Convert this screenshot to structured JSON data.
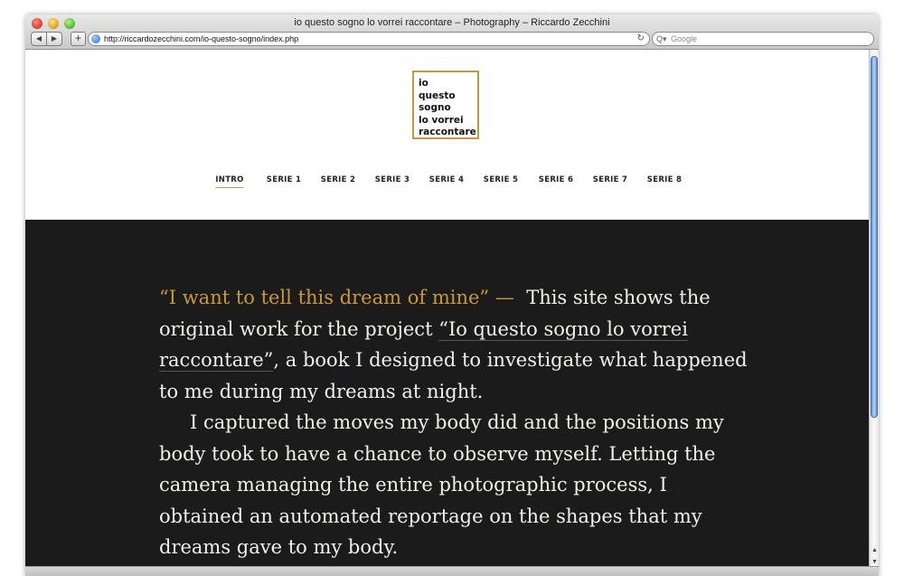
{
  "window": {
    "title": "io questo sogno lo vorrei raccontare – Photography – Riccardo Zecchini"
  },
  "toolbar": {
    "back_icon": "◀",
    "forward_icon": "▶",
    "add_icon": "+",
    "url": "http://riccardozecchini.com/io-questo-sogno/index.php",
    "reload_icon": "↻",
    "search_placeholder": "Google",
    "search_icon": "Q▾"
  },
  "logo": {
    "lines": [
      "io",
      "questo",
      "sogno",
      "lo vorrei",
      "raccontare"
    ],
    "border_color": "#c29a43"
  },
  "nav": {
    "items": [
      {
        "label": "INTRO",
        "active": true
      },
      {
        "label": "SERIE 1"
      },
      {
        "label": "SERIE 2"
      },
      {
        "label": "SERIE 3"
      },
      {
        "label": "SERIE 4"
      },
      {
        "label": "SERIE 5"
      },
      {
        "label": "SERIE 6"
      },
      {
        "label": "SERIE 7"
      },
      {
        "label": "SERIE 8"
      }
    ]
  },
  "content": {
    "quote": "“I want to tell this dream of mine”",
    "dash": "—",
    "p1_a": "This site shows the original work for the project",
    "p1_link": "“Io questo sogno lo vorrei raccontare”",
    "p1_b": ", a book I designed to investigate what happened to me during my dreams at night.",
    "p2": "I captured the moves my body did and the positions my body took to have a chance to observe myself. Letting the camera managing the entire photographic process, I obtained an automated reportage on the shapes that my dreams gave to my body."
  },
  "colors": {
    "accent": "#c99838",
    "dark_bg": "#1b1b1b",
    "text_light": "#f2f0ea"
  }
}
